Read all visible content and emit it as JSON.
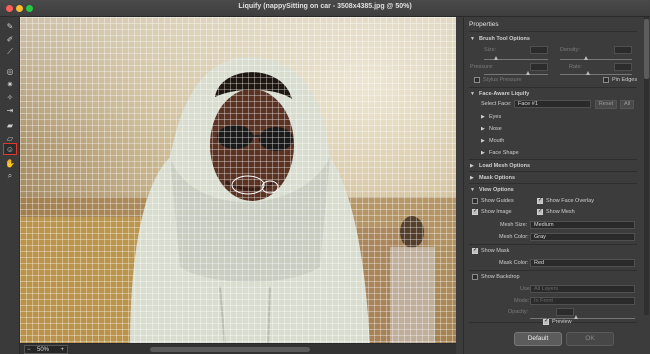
{
  "window": {
    "title": "Liquify (nappySitting on car - 3508x4385.jpg @ 50%)"
  },
  "status": {
    "zoom": "50%"
  },
  "panel": {
    "title": "Properties",
    "brush": {
      "title": "Brush Tool Options",
      "size": "Size:",
      "density": "Density:",
      "pressure": "Pressure:",
      "rate": "Rate:",
      "stylus": "Stylus Pressure",
      "pin": "Pin Edges"
    },
    "face": {
      "title": "Face-Aware Liquify",
      "select_label": "Select Face:",
      "select_value": "Face #1",
      "reset": "Reset",
      "all": "All",
      "items": [
        "Eyes",
        "Nose",
        "Mouth",
        "Face Shape"
      ]
    },
    "load": "Load Mesh Options",
    "mask": "Mask Options",
    "view": {
      "title": "View Options",
      "guides": "Show Guides",
      "overlay": "Show Face Overlay",
      "image": "Show Image",
      "mesh": "Show Mesh",
      "mesh_size_label": "Mesh Size:",
      "mesh_size": "Medium",
      "mesh_color_label": "Mesh Color:",
      "mesh_color": "Gray",
      "show_mask": "Show Mask",
      "mask_color_label": "Mask Color:",
      "mask_color": "Red",
      "backdrop": "Show Backdrop",
      "use_label": "Use:",
      "use": "All Layers",
      "mode_label": "Mode:",
      "mode": "In Front",
      "opacity_label": "Opacity:"
    },
    "preview": "Preview",
    "default_btn": "Default",
    "ok_btn": "OK"
  },
  "icons": [
    "forward-warp-icon",
    "reconstruct-icon",
    "smooth-icon",
    "twirl-icon",
    "pucker-icon",
    "bloat-icon",
    "push-left-icon",
    "freeze-mask-icon",
    "thaw-mask-icon",
    "face-tool-icon",
    "hand-icon",
    "zoom-icon"
  ]
}
